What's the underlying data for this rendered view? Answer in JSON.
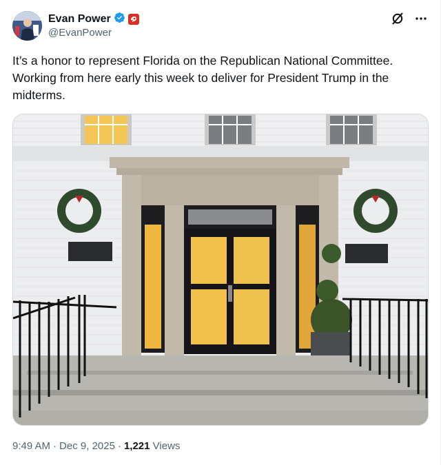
{
  "author": {
    "name": "Evan Power",
    "handle": "@EvanPower"
  },
  "icons": {
    "verified": "verified-badge-icon",
    "affiliation": "affiliation-badge-icon",
    "grok": "grok-icon",
    "more": "more-icon"
  },
  "tweet": {
    "text": "It’s a honor to represent Florida on the Republican National Committee. Working from here early this week to deliver for President Trump in the midterms.",
    "image_alt": ""
  },
  "meta": {
    "time": "9:49 AM",
    "date": "Dec 9, 2025",
    "views_count": "1,221",
    "views_label": "Views",
    "sep": "·"
  },
  "colors": {
    "verified_blue": "#1d9bf0",
    "affiliation_red": "#d93025",
    "secondary_text": "#536471"
  }
}
